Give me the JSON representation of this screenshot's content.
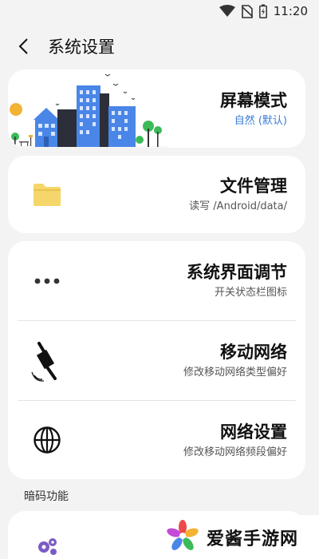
{
  "status_bar": {
    "time": "11:20",
    "icons": [
      "wifi-icon",
      "no-sim-icon",
      "battery-charging-icon"
    ]
  },
  "header": {
    "back_icon": "chevron-left-icon",
    "title": "系统设置"
  },
  "cards": {
    "screen_mode": {
      "title": "屏幕模式",
      "subtitle": "自然 (默认)",
      "illustration": "city-illustration"
    },
    "file_management": {
      "title": "文件管理",
      "subtitle": "读写 /Android/data/",
      "icon": "folder-icon"
    },
    "system_ui": {
      "title": "系统界面调节",
      "subtitle": "开关状态栏图标",
      "icon": "more-dots-icon"
    },
    "mobile_network": {
      "title": "移动网络",
      "subtitle": "修改移动网络类型偏好",
      "icon": "satellite-icon"
    },
    "network_settings": {
      "title": "网络设置",
      "subtitle": "修改移动网络频段偏好",
      "icon": "globe-icon"
    }
  },
  "section": {
    "secret_codes_label": "暗码功能",
    "next_icon": "gears-icon"
  },
  "watermark": {
    "text": "爱酱手游网",
    "logo": "flower-logo"
  },
  "colors": {
    "background": "#f3f3f3",
    "card": "#ffffff",
    "accent": "#3a7bd5",
    "folder": "#f5d66a"
  }
}
